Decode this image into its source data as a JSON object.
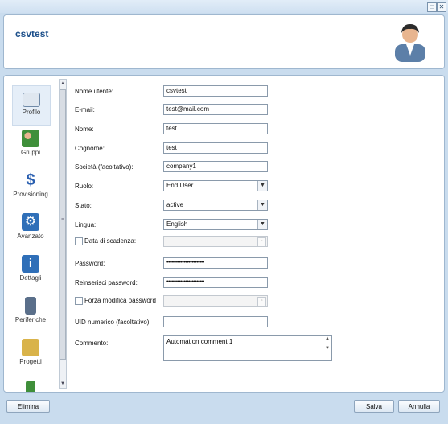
{
  "header": {
    "title": "csvtest"
  },
  "nav": [
    {
      "label": "Profilo",
      "icon": "profile-icon",
      "color": "#6f8aa8"
    },
    {
      "label": "Gruppi",
      "icon": "groups-icon",
      "color": "#3f8f3a"
    },
    {
      "label": "Provisioning",
      "icon": "dollar-icon",
      "color": "#2a5fb0"
    },
    {
      "label": "Avanzato",
      "icon": "gear-icon",
      "color": "#2f6fb8"
    },
    {
      "label": "Dettagli",
      "icon": "info-icon",
      "color": "#2f6fb8"
    },
    {
      "label": "Periferiche",
      "icon": "phone-icon",
      "color": "#5a6f8a"
    },
    {
      "label": "Progetti",
      "icon": "folder-icon",
      "color": "#d9b34a"
    }
  ],
  "form": {
    "username": {
      "label": "Nome utente:",
      "value": "csvtest"
    },
    "email": {
      "label": "E-mail:",
      "value": "test@mail.com"
    },
    "firstname": {
      "label": "Nome:",
      "value": "test"
    },
    "lastname": {
      "label": "Cognome:",
      "value": "test"
    },
    "company": {
      "label": "Società (facoltativo):",
      "value": "company1"
    },
    "role": {
      "label": "Ruolo:",
      "value": "End User"
    },
    "status": {
      "label": "Stato:",
      "value": "active"
    },
    "language": {
      "label": "Lingua:",
      "value": "English"
    },
    "expiry": {
      "label": "Data di scadenza:",
      "value": ""
    },
    "password": {
      "label": "Password:",
      "value": "••••••••••••••••••••••••"
    },
    "password_confirm": {
      "label": "Reinserisci password:",
      "value": "••••••••••••••••••••••••"
    },
    "force_change": {
      "label": "Forza modifica password",
      "value": ""
    },
    "uid": {
      "label": "UID numerico (facoltativo):",
      "value": ""
    },
    "comment": {
      "label": "Commento:",
      "value": "Automation comment 1"
    }
  },
  "buttons": {
    "delete": "Elimina",
    "save": "Salva",
    "cancel": "Annulla"
  }
}
